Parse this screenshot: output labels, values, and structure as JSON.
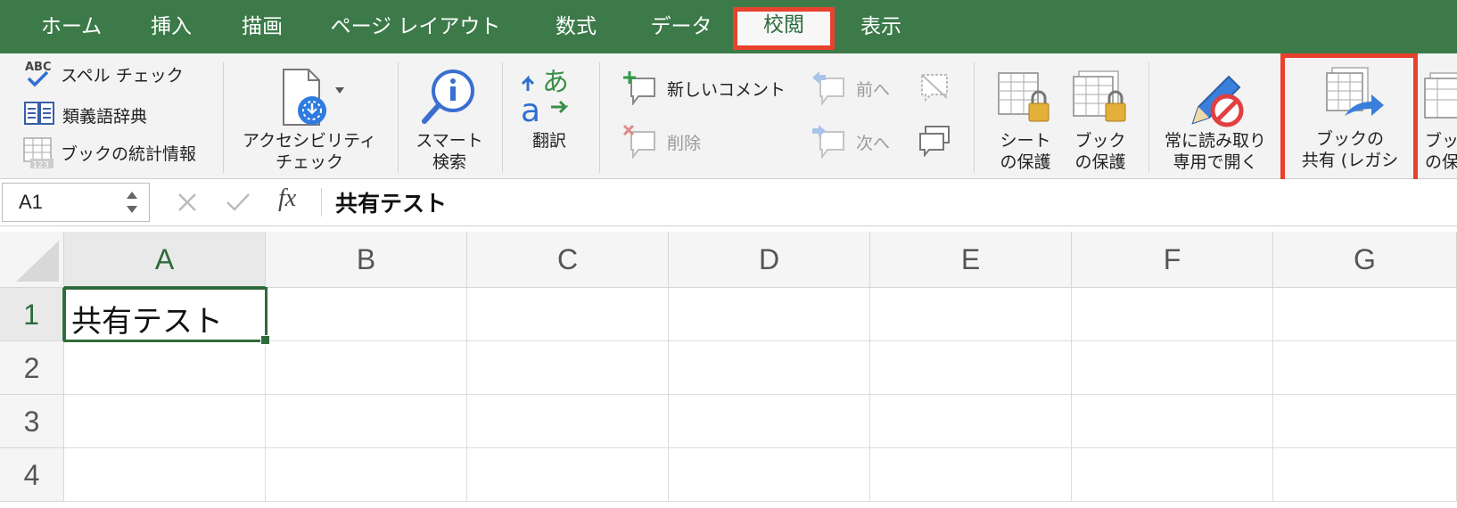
{
  "tabs": [
    "ホーム",
    "挿入",
    "描画",
    "ページ レイアウト",
    "数式",
    "データ",
    "校閲",
    "表示"
  ],
  "active_tab": "校閲",
  "ribbon": {
    "proofing": {
      "spellcheck": "スペル チェック",
      "thesaurus": "類義語辞典",
      "statistics": "ブックの統計情報"
    },
    "accessibility": {
      "line1": "アクセシビリティ",
      "line2": "チェック"
    },
    "smart_lookup": {
      "line1": "スマート",
      "line2": "検索"
    },
    "translate": "翻訳",
    "comments": {
      "new": "新しいコメント",
      "delete": "削除",
      "previous": "前へ",
      "next": "次へ"
    },
    "protect_sheet": {
      "line1": "シート",
      "line2": "の保護"
    },
    "protect_book": {
      "line1": "ブック",
      "line2": "の保護"
    },
    "read_only": {
      "line1": "常に読み取り",
      "line2": "専用で開く"
    },
    "share_workbook": {
      "line1": "ブックの",
      "line2": "共有 (レガシ"
    },
    "truncated": {
      "line1": "ブッ",
      "line2": "の保"
    }
  },
  "formula_bar": {
    "name_box": "A1",
    "fx": "fx",
    "value": "共有テスト"
  },
  "grid": {
    "columns": [
      "A",
      "B",
      "C",
      "D",
      "E",
      "F",
      "G"
    ],
    "rows": [
      "1",
      "2",
      "3",
      "4"
    ],
    "cells": {
      "A1": "共有テスト"
    }
  },
  "colors": {
    "accent": "#3c7a49",
    "highlight": "#e8412d"
  }
}
